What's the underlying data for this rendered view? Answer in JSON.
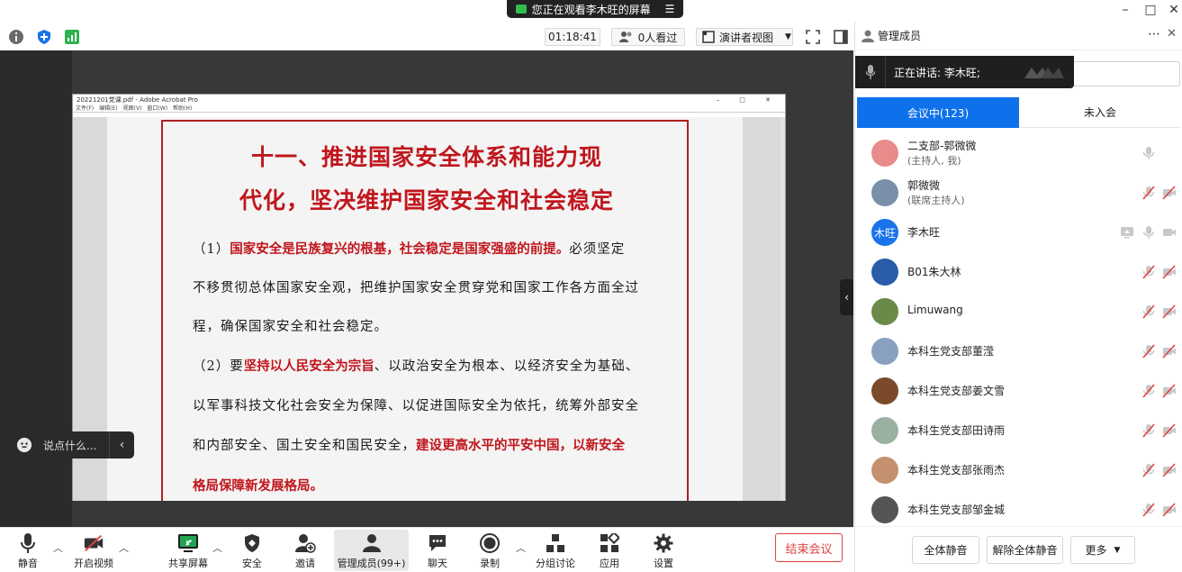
{
  "share_banner": {
    "text": "您正在观看李木旺的屏幕",
    "menu_icon": "menu-icon"
  },
  "window_controls": {
    "minimize": "–",
    "maximize": "□",
    "close": "✕"
  },
  "infobar": {
    "timer": "01:18:41",
    "viewers": "0人看过",
    "view_mode": "演讲者视图",
    "icons": [
      "info-icon",
      "shield-icon",
      "signal-icon",
      "fullscreen-icon",
      "sidebar-toggle-icon"
    ]
  },
  "pdf": {
    "window_title": "20221201党课.pdf - Adobe Acrobat Pro",
    "menu": [
      "文件(F)",
      "编辑(E)",
      "视图(V)",
      "窗口(W)",
      "帮助(H)"
    ],
    "title_line1": "十一、推进国家安全体系和能力现",
    "title_line2": "代化，坚决维护国家安全和社会稳定",
    "p1_prefix": "（1）",
    "p1_em": "国家安全是民族复兴的根基，社会稳定是国家强盛的前提。",
    "p1_tail": "必须坚定",
    "p1_line2": "不移贯彻总体国家安全观，把维护国家安全贯穿党和国家工作各方面全过",
    "p1_line3": "程，确保国家安全和社会稳定。",
    "p2_prefix": "（2）要",
    "p2_em": "坚持以人民安全为宗旨",
    "p2_tail": "、以政治安全为根本、以经济安全为基础、",
    "p2_line2": "以军事科技文化社会安全为保障、以促进国际安全为依托，统筹外部安全",
    "p2_line3_a": "和内部安全、国土安全和国民安全，",
    "p2_line3_em": "建设更高水平的平安中国，以新安全",
    "p2_line4_em": "格局保障新发展格局。"
  },
  "chat": {
    "placeholder": "说点什么..."
  },
  "toolbar": {
    "mute": "静音",
    "video": "开启视频",
    "share": "共享屏幕",
    "security": "安全",
    "invite": "邀请",
    "participants": "管理成员(99+)",
    "chat": "聊天",
    "record": "录制",
    "breakout": "分组讨论",
    "apps": "应用",
    "settings": "设置",
    "end": "结束会议"
  },
  "panel": {
    "title": "管理成员",
    "speaking": "正在讲话: 李木旺;",
    "tab_in": "会议中(123)",
    "tab_out": "未入会",
    "participants": [
      {
        "name": "二支部-郭微微",
        "role": "(主持人, 我)",
        "avatar_color": "#e88b8b",
        "avatar_text": "",
        "mic": "mic",
        "cam": ""
      },
      {
        "name": "郭微微",
        "role": "(联席主持人)",
        "avatar_color": "#7a8fa8",
        "avatar_text": "",
        "mic": "mic-off",
        "cam": "cam-off"
      },
      {
        "name": "李木旺",
        "role": "",
        "avatar_color": "#1a73e8",
        "avatar_text": "木旺",
        "mic": "mic",
        "cam": "cam",
        "share": "share"
      },
      {
        "name": "B01朱大林",
        "role": "",
        "avatar_color": "#2a5da8",
        "avatar_text": "",
        "mic": "mic-off",
        "cam": "cam-off"
      },
      {
        "name": "Limuwang",
        "role": "",
        "avatar_color": "#6b8a4a",
        "avatar_text": "",
        "mic": "mic-off",
        "cam": "cam-off"
      },
      {
        "name": "本科生党支部董滢",
        "role": "",
        "avatar_color": "#8aa0c0",
        "avatar_text": "",
        "mic": "mic-off",
        "cam": "cam-off"
      },
      {
        "name": "本科生党支部姜文雪",
        "role": "",
        "avatar_color": "#7a4a2a",
        "avatar_text": "",
        "mic": "mic-off",
        "cam": "cam-off"
      },
      {
        "name": "本科生党支部田诗雨",
        "role": "",
        "avatar_color": "#9ab0a0",
        "avatar_text": "",
        "mic": "mic-off",
        "cam": "cam-off"
      },
      {
        "name": "本科生党支部张雨杰",
        "role": "",
        "avatar_color": "#c49070",
        "avatar_text": "",
        "mic": "mic-off",
        "cam": "cam-off"
      },
      {
        "name": "本科生党支部邹金城",
        "role": "",
        "avatar_color": "#555555",
        "avatar_text": "",
        "mic": "mic-off",
        "cam": "cam-off"
      }
    ],
    "footer": {
      "mute_all": "全体静音",
      "unmute_all": "解除全体静音",
      "more": "更多"
    }
  },
  "colors": {
    "accent": "#0e71eb",
    "danger": "#e04343",
    "slide_red": "#c0161d",
    "green": "#2fbf4f"
  }
}
